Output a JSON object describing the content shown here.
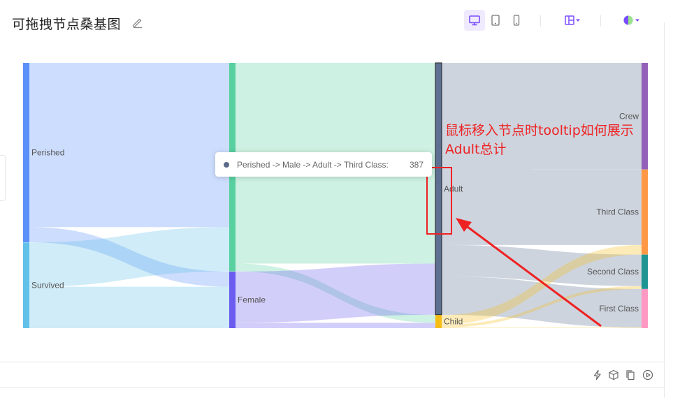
{
  "header": {
    "title": "可拖拽节点桑基图"
  },
  "tooltip": {
    "label": "Perished -> Male -> Adult -> Third Class:",
    "value": "387"
  },
  "annotation": {
    "text": "鼠标移入节点时tooltip如何展示Adult总计",
    "color": "#ee2222"
  },
  "colors": {
    "accent": "#7c4dff"
  },
  "chart_data": {
    "type": "sankey",
    "nodes": [
      {
        "name": "Perished",
        "color": "#5b8ff9"
      },
      {
        "name": "Survived",
        "color": "#61c1e8"
      },
      {
        "name": "Male",
        "color": "#58d0a0",
        "label": ""
      },
      {
        "name": "Female",
        "color": "#6b5cf0"
      },
      {
        "name": "Adult",
        "color": "#5d7092"
      },
      {
        "name": "Child",
        "color": "#f6bd16"
      },
      {
        "name": "Crew",
        "color": "#945fb9"
      },
      {
        "name": "Third Class",
        "color": "#ff9845"
      },
      {
        "name": "Second Class",
        "color": "#1e9493"
      },
      {
        "name": "First Class",
        "color": "#ff99c3"
      }
    ],
    "links": [
      {
        "source": "Perished",
        "target": "Male",
        "value": 1364
      },
      {
        "source": "Perished",
        "target": "Female",
        "value": 126
      },
      {
        "source": "Survived",
        "target": "Male",
        "value": 367
      },
      {
        "source": "Survived",
        "target": "Female",
        "value": 344
      },
      {
        "source": "Male",
        "target": "Adult",
        "value": 1667
      },
      {
        "source": "Male",
        "target": "Child",
        "value": 64
      },
      {
        "source": "Female",
        "target": "Adult",
        "value": 425
      },
      {
        "source": "Female",
        "target": "Child",
        "value": 45
      },
      {
        "source": "Adult",
        "target": "Crew",
        "value": 885
      },
      {
        "source": "Adult",
        "target": "Third Class",
        "value": 627
      },
      {
        "source": "Adult",
        "target": "Second Class",
        "value": 261
      },
      {
        "source": "Adult",
        "target": "First Class",
        "value": 319
      },
      {
        "source": "Child",
        "target": "Third Class",
        "value": 79
      },
      {
        "source": "Child",
        "target": "Second Class",
        "value": 24
      },
      {
        "source": "Child",
        "target": "First Class",
        "value": 6
      }
    ]
  }
}
